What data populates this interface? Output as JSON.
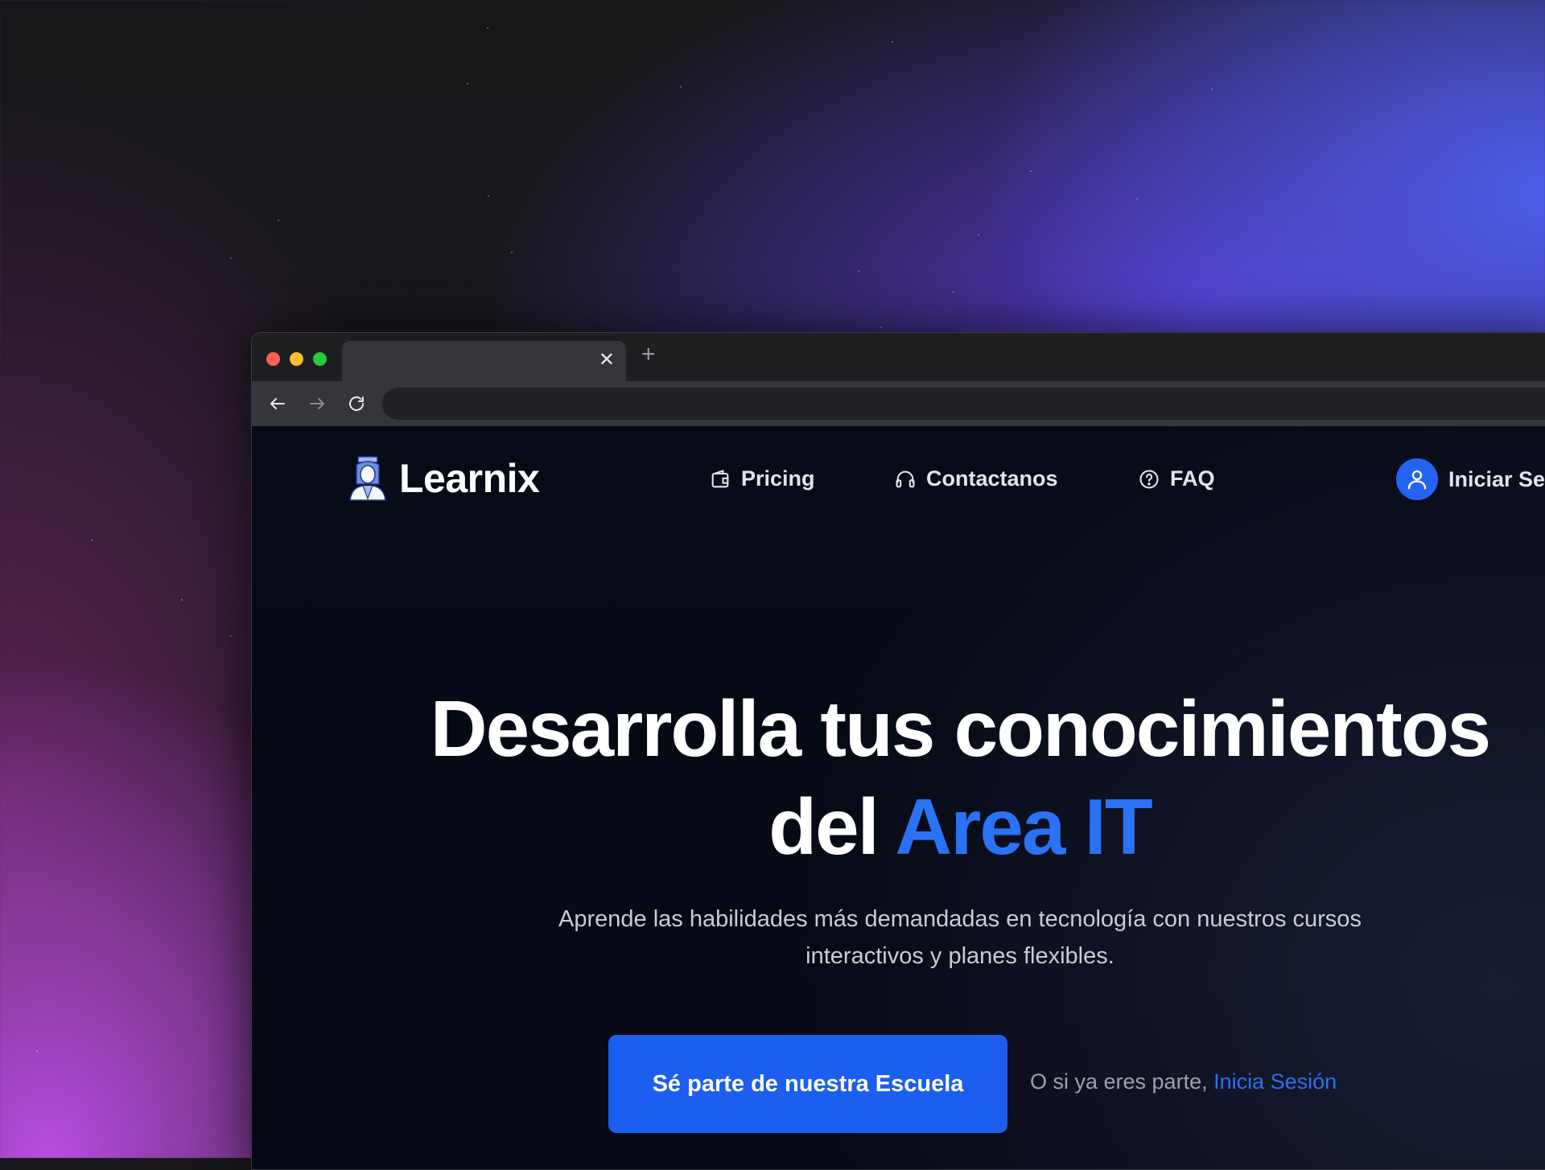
{
  "browser": {
    "tab_close_glyph": "✕",
    "new_tab_glyph": "+",
    "address_bar_value": ""
  },
  "site": {
    "brand": "Learnix",
    "nav": {
      "pricing": "Pricing",
      "contact": "Contactanos",
      "faq": "FAQ"
    },
    "login_label": "Iniciar Sesión"
  },
  "hero": {
    "title_line1": "Desarrolla tus conocimientos",
    "title_line2_prefix": "del ",
    "title_line2_accent": "Area IT",
    "subtitle": "Aprende las habilidades más demandadas en tecnología con nuestros cursos interactivos y planes flexibles.",
    "cta_label": "Sé parte de nuestra Escuela",
    "alt_prefix": "O si ya eres parte, ",
    "alt_link": "Inicia Sesión"
  },
  "icons": {
    "brand": "student-graduate-icon",
    "pricing": "wallet-icon",
    "contact": "headset-icon",
    "faq": "help-circle-icon",
    "login": "user-icon"
  },
  "colors": {
    "accent": "#2a72f6",
    "cta_background": "#1b5ef0",
    "page_background": "#060914",
    "chrome_background": "#1f1f22"
  }
}
